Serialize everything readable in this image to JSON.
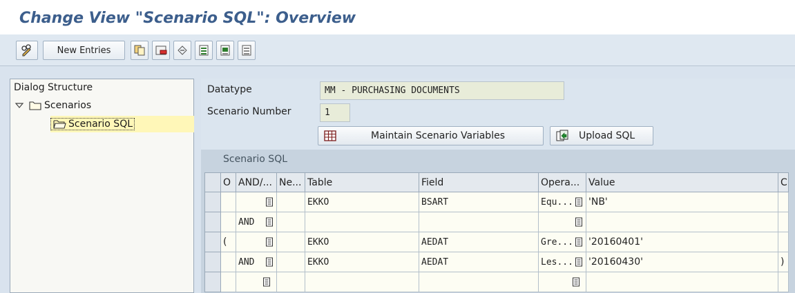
{
  "title": "Change View \"Scenario SQL\": Overview",
  "toolbar": {
    "new_entries_label": "New Entries"
  },
  "dialog_structure": {
    "title": "Dialog Structure",
    "items": [
      {
        "label": "Scenarios"
      },
      {
        "label": "Scenario SQL"
      }
    ]
  },
  "header": {
    "datatype_label": "Datatype",
    "datatype_value": "MM - PURCHASING DOCUMENTS",
    "scenario_number_label": "Scenario Number",
    "scenario_number_value": "1"
  },
  "buttons": {
    "maintain_label": "Maintain Scenario Variables",
    "upload_label": "Upload SQL"
  },
  "table": {
    "caption": "Scenario SQL",
    "headers": {
      "o": "O",
      "and_or": "AND/...",
      "negation": "Ne...",
      "table": "Table",
      "field": "Field",
      "operator": "Opera...",
      "value": "Value",
      "c": "C"
    },
    "rows": [
      {
        "o": "",
        "and_or": "",
        "negation": "",
        "table": "EKKO",
        "field": "BSART",
        "operator": "Equ...",
        "value": "'NB'",
        "c": ""
      },
      {
        "o": "",
        "and_or": "AND",
        "negation": "",
        "table": "",
        "field": "",
        "operator": "",
        "value": "",
        "c": ""
      },
      {
        "o": "(",
        "and_or": "",
        "negation": "",
        "table": "EKKO",
        "field": "AEDAT",
        "operator": "Gre...",
        "value": "'20160401'",
        "c": ""
      },
      {
        "o": "",
        "and_or": "AND",
        "negation": "",
        "table": "EKKO",
        "field": "AEDAT",
        "operator": "Les...",
        "value": "'20160430'",
        "c": ")"
      }
    ]
  },
  "colors": {
    "title": "#3c5e8c",
    "toolbar_bg": "#dfe8f1",
    "panel_bg": "#d9e3ee",
    "selected_tree_bg": "#fff7b8",
    "cell_bg": "#fdfdf3"
  }
}
